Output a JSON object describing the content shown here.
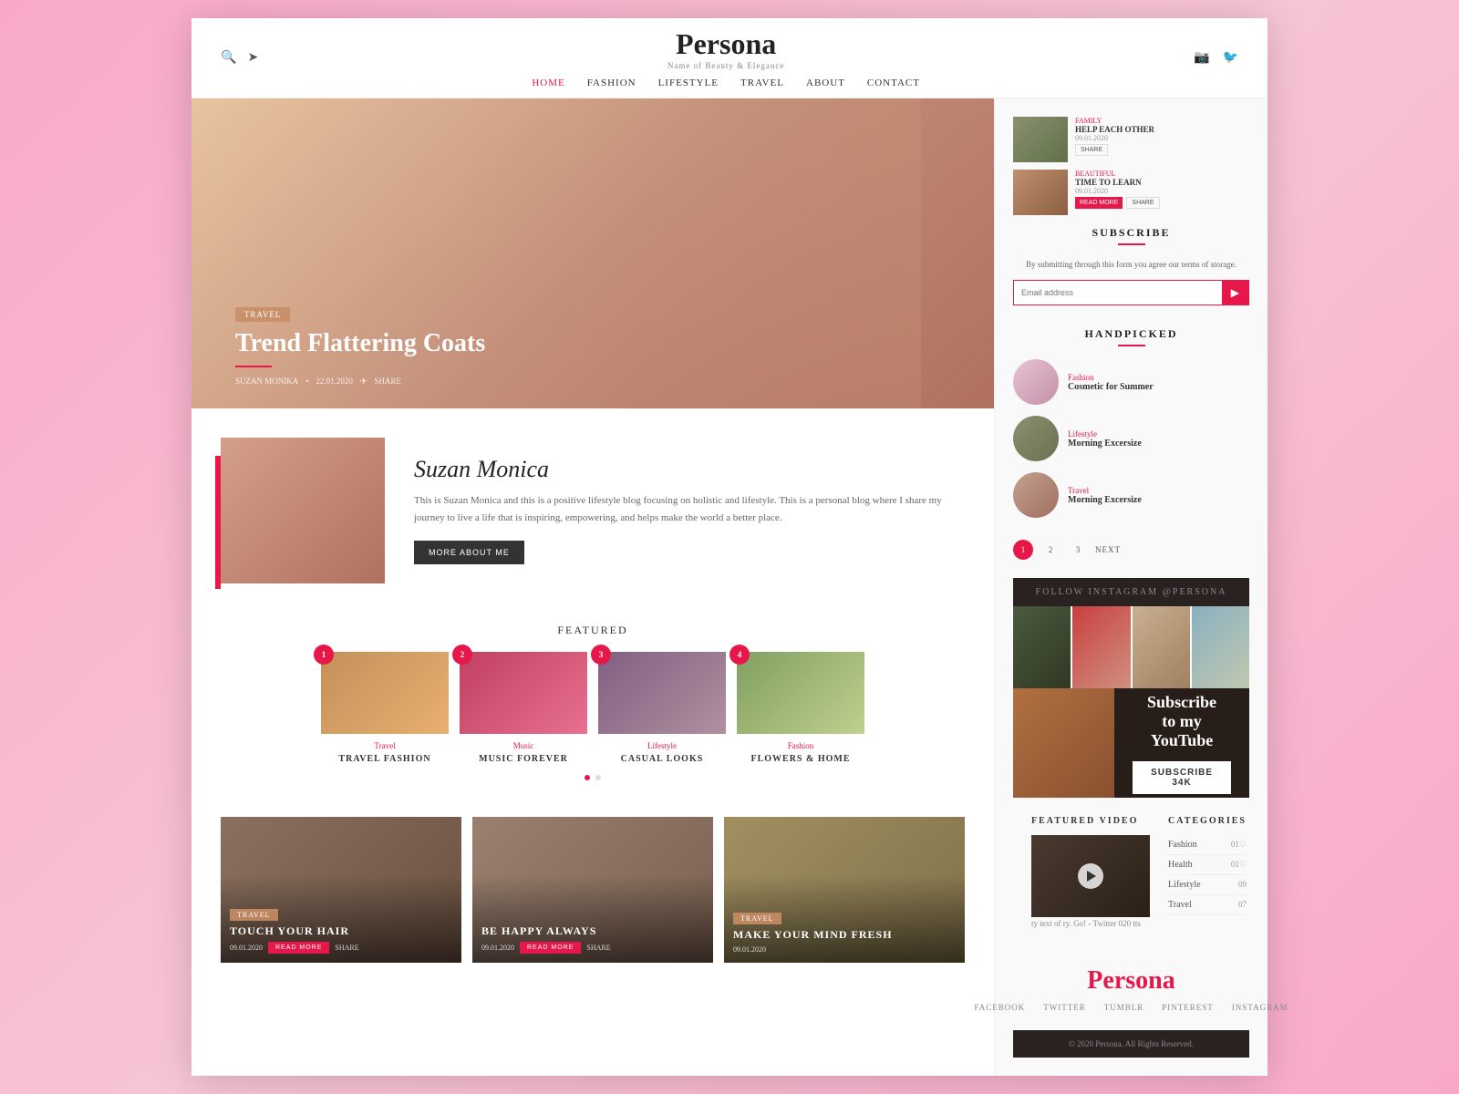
{
  "header": {
    "logo_p": "P",
    "logo_rest": "ersona",
    "logo_tagline": "Name of Beauty & Elegance",
    "nav": [
      "HOME",
      "FASHION",
      "LIFESTYLE",
      "TRAVEL",
      "ABOUT",
      "CONTACT"
    ],
    "active_nav": "HOME"
  },
  "hero": {
    "tag": "TRAVEL",
    "title": "Trend Flattering Coats",
    "author": "SUZAN MONIKA",
    "date": "22.01.2020",
    "share": "SHARE"
  },
  "about": {
    "name": "Suzan Monica",
    "desc": "This is Suzan Monica and this is a positive lifestyle blog focusing on holistic and lifestyle. This is a personal blog where I share my journey to live a life that is inspiring, empowering, and helps make the world a better place.",
    "btn": "MORE ABOUT ME"
  },
  "featured": {
    "title": "FEATURED",
    "items": [
      {
        "num": "1",
        "cat": "Travel",
        "label": "TRAVEL FASHION"
      },
      {
        "num": "2",
        "cat": "Music",
        "label": "MUSIC FOREVER"
      },
      {
        "num": "3",
        "cat": "Lifestyle",
        "label": "CASUAL LOOKS"
      },
      {
        "num": "4",
        "cat": "Fashion",
        "label": "FLOWERS & HOME"
      }
    ]
  },
  "bottom_cards": [
    {
      "tag": "TRAVEL",
      "title": "TOUCH YOUR HAIR",
      "date": "09.01.2020",
      "read_more": "READ MORE",
      "share": "SHARE"
    },
    {
      "tag": "",
      "title": "BE HAPPY ALWAYS",
      "date": "09.01.2020",
      "read_more": "READ MORE",
      "share": "SHARE"
    },
    {
      "tag": "TRAVEL",
      "title": "Make Your Mind Fresh",
      "date": "09.01.2020",
      "read_more": "",
      "share": ""
    }
  ],
  "sidebar": {
    "subscribe": {
      "title": "SUBSCRIBE",
      "desc": "By submitting through this form you agree our terms of storage.",
      "placeholder": "Email address",
      "btn": "▶"
    },
    "handpicked": {
      "title": "HANDPICKED",
      "items": [
        {
          "cat": "Fashion",
          "label": "Cosmetic for Summer"
        },
        {
          "cat": "Lifestyle",
          "label": "Morning Excersize"
        },
        {
          "cat": "Travel",
          "label": "Morning Excersize"
        }
      ]
    },
    "pagination": {
      "pages": [
        "1",
        "2",
        "3"
      ],
      "next": "NEXT"
    },
    "instagram": {
      "bar_text": "FOLLOW INSTAGRAM @PERSONA"
    },
    "youtube": {
      "title": "Subscribe\nto my YouTube",
      "btn": "SUBSCRIBE 34K"
    },
    "featured_video": {
      "title": "FEATURED VIDEO",
      "text": "ty text of ry. Go! - Twitter 020 tts"
    },
    "categories": {
      "title": "CATEGORIES",
      "items": [
        {
          "name": "Fashion",
          "count": "01♡"
        },
        {
          "name": "Health",
          "count": "01♡"
        },
        {
          "name": "Lifestyle",
          "count": "09"
        },
        {
          "name": "Travel",
          "count": "07"
        }
      ]
    },
    "footer_logo": "Persona",
    "footer_social": [
      "FACEBOOK",
      "TWITTER",
      "TUMBLR",
      "PINTEREST",
      "INSTAGRAM"
    ],
    "footer_bar": "© 2020 Persona. All Rights Reserved.",
    "recent_posts": [
      {
        "cat": "FAMILY",
        "title": "HELP EACH OTHER",
        "date": "09.01.2020"
      },
      {
        "cat": "BEAUTIFUL",
        "title": "TIME TO LEARN",
        "date": "09.01.2020"
      }
    ]
  }
}
